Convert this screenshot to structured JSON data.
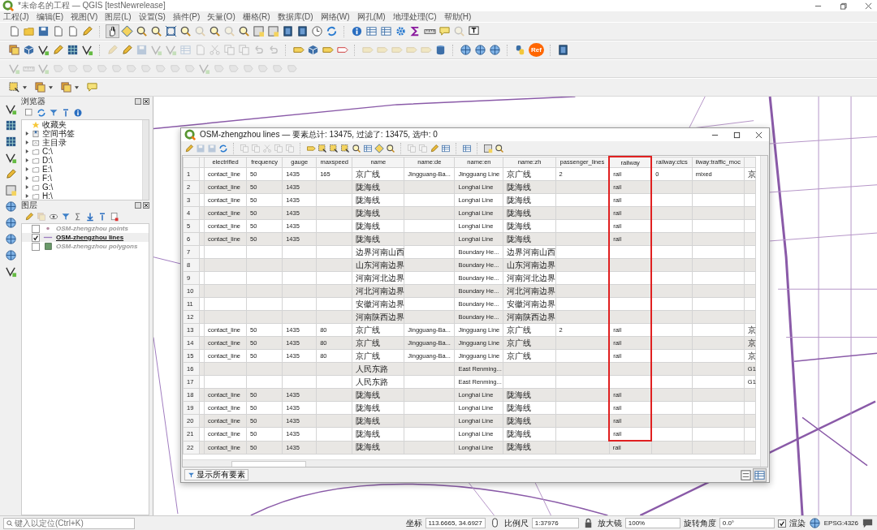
{
  "window": {
    "title": "*未命名的工程 — QGIS [testNewrelease]"
  },
  "menu": [
    "工程(J)",
    "编辑(E)",
    "视图(V)",
    "图层(L)",
    "设置(S)",
    "插件(P)",
    "矢量(O)",
    "栅格(R)",
    "数据库(D)",
    "网络(W)",
    "网孔(M)",
    "地理处理(C)",
    "帮助(H)"
  ],
  "toolbar": {
    "plugin_badge": "Ref"
  },
  "browser": {
    "title": "浏览器",
    "items": [
      {
        "label": "收藏夹",
        "kind": "favorites",
        "expandable": false
      },
      {
        "label": "空间书签",
        "kind": "bookmarks",
        "expandable": true
      },
      {
        "label": "主目录",
        "kind": "home",
        "expandable": true
      },
      {
        "label": "C:\\",
        "kind": "folder",
        "expandable": true
      },
      {
        "label": "D:\\",
        "kind": "folder",
        "expandable": true
      },
      {
        "label": "E:\\",
        "kind": "folder",
        "expandable": true
      },
      {
        "label": "F:\\",
        "kind": "folder",
        "expandable": true
      },
      {
        "label": "G:\\",
        "kind": "folder",
        "expandable": true
      },
      {
        "label": "H:\\",
        "kind": "folder",
        "expandable": true
      }
    ]
  },
  "layers": {
    "title": "图层",
    "items": [
      {
        "name": "OSM-zhengzhou points",
        "kind": "point",
        "checked": false,
        "current": false
      },
      {
        "name": "OSM-zhengzhou lines",
        "kind": "line",
        "checked": true,
        "current": true
      },
      {
        "name": "OSM-zhengzhou polygons",
        "kind": "polygon",
        "checked": false,
        "current": false
      }
    ]
  },
  "attribute_table": {
    "title": "OSM-zhengzhou lines — 要素总计: 13475, 过滤了: 13475, 选中: 0",
    "columns": [
      {
        "label": "electrified",
        "highlighted": false
      },
      {
        "label": "frequency",
        "highlighted": false
      },
      {
        "label": "gauge",
        "highlighted": false
      },
      {
        "label": "maxspeed",
        "highlighted": false
      },
      {
        "label": "name",
        "highlighted": false
      },
      {
        "label": "name:de",
        "highlighted": false
      },
      {
        "label": "name:en",
        "highlighted": false
      },
      {
        "label": "name:zh",
        "highlighted": false
      },
      {
        "label": "passenger_lines",
        "highlighted": false
      },
      {
        "label": "railway",
        "highlighted": true
      },
      {
        "label": "railway:ctcs",
        "highlighted": false
      },
      {
        "label": "ilway:traffic_moc",
        "highlighted": false
      },
      {
        "highlighted": false
      }
    ],
    "rows": [
      {
        "number": "1",
        "highlighted": true,
        "cells": [
          "contact_line",
          "50",
          "1435",
          "165",
          "京广线",
          "Jingguang-Ba...",
          "Jingguang Line",
          "京广线",
          "2",
          "rail",
          "0",
          "mixed",
          "京"
        ]
      },
      {
        "number": "2",
        "highlighted": true,
        "cells": [
          "contact_line",
          "50",
          "1435",
          null,
          "陇海线",
          null,
          "Longhai Line",
          "陇海线",
          null,
          "rail",
          null,
          null,
          null
        ]
      },
      {
        "number": "3",
        "highlighted": true,
        "cells": [
          "contact_line",
          "50",
          "1435",
          null,
          "陇海线",
          null,
          "Longhai Line",
          "陇海线",
          null,
          "rail",
          null,
          null,
          null
        ]
      },
      {
        "number": "4",
        "highlighted": true,
        "cells": [
          "contact_line",
          "50",
          "1435",
          null,
          "陇海线",
          null,
          "Longhai Line",
          "陇海线",
          null,
          "rail",
          null,
          null,
          null
        ]
      },
      {
        "number": "5",
        "highlighted": true,
        "cells": [
          "contact_line",
          "50",
          "1435",
          null,
          "陇海线",
          null,
          "Longhai Line",
          "陇海线",
          null,
          "rail",
          null,
          null,
          null
        ]
      },
      {
        "number": "6",
        "highlighted": true,
        "cells": [
          "contact_line",
          "50",
          "1435",
          null,
          "陇海线",
          null,
          "Longhai Line",
          "陇海线",
          null,
          "rail",
          null,
          null,
          null
        ]
      },
      {
        "number": "7",
        "highlighted": true,
        "cells": [
          null,
          null,
          null,
          null,
          "边界河南山西",
          null,
          "Boundary He...",
          "边界河南山西",
          null,
          null,
          null,
          null,
          null
        ]
      },
      {
        "number": "8",
        "highlighted": true,
        "cells": [
          null,
          null,
          null,
          null,
          "山东河南边界",
          null,
          "Boundary He...",
          "山东河南边界",
          null,
          null,
          null,
          null,
          null
        ]
      },
      {
        "number": "9",
        "highlighted": true,
        "cells": [
          null,
          null,
          null,
          null,
          "河南河北边界",
          null,
          "Boundary He...",
          "河南河北边界",
          null,
          null,
          null,
          null,
          null
        ]
      },
      {
        "number": "10",
        "highlighted": true,
        "cells": [
          null,
          null,
          null,
          null,
          "河北河南边界",
          null,
          "Boundary He...",
          "河北河南边界",
          null,
          null,
          null,
          null,
          null
        ]
      },
      {
        "number": "11",
        "highlighted": true,
        "cells": [
          null,
          null,
          null,
          null,
          "安徽河南边界",
          null,
          "Boundary He...",
          "安徽河南边界",
          null,
          null,
          null,
          null,
          null
        ]
      },
      {
        "number": "12",
        "highlighted": true,
        "cells": [
          null,
          null,
          null,
          null,
          "河南陕西边界",
          null,
          "Boundary He...",
          "河南陕西边界",
          null,
          null,
          null,
          null,
          null
        ]
      },
      {
        "number": "13",
        "highlighted": true,
        "cells": [
          "contact_line",
          "50",
          "1435",
          "80",
          "京广线",
          "Jingguang-Ba...",
          "Jingguang Line",
          "京广线",
          "2",
          "rail",
          null,
          null,
          "京"
        ]
      },
      {
        "number": "14",
        "highlighted": true,
        "cells": [
          "contact_line",
          "50",
          "1435",
          "80",
          "京广线",
          "Jingguang-Ba...",
          "Jingguang Line",
          "京广线",
          null,
          "rail",
          null,
          null,
          "京"
        ]
      },
      {
        "number": "15",
        "highlighted": true,
        "cells": [
          "contact_line",
          "50",
          "1435",
          "80",
          "京广线",
          "Jingguang-Ba...",
          "Jingguang Line",
          "京广线",
          null,
          "rail",
          null,
          null,
          "京"
        ]
      },
      {
        "number": "16",
        "highlighted": true,
        "cells": [
          null,
          null,
          null,
          null,
          "人民东路",
          null,
          "East Renming...",
          null,
          null,
          null,
          null,
          null,
          "G1"
        ]
      },
      {
        "number": "17",
        "highlighted": true,
        "cells": [
          null,
          null,
          null,
          null,
          "人民东路",
          null,
          "East Renming...",
          null,
          null,
          null,
          null,
          null,
          "G1"
        ]
      },
      {
        "number": "18",
        "highlighted": true,
        "cells": [
          "contact_line",
          "50",
          "1435",
          null,
          "陇海线",
          null,
          "Longhai Line",
          "陇海线",
          null,
          "rail",
          null,
          null,
          null
        ]
      },
      {
        "number": "19",
        "highlighted": true,
        "cells": [
          "contact_line",
          "50",
          "1435",
          null,
          "陇海线",
          null,
          "Longhai Line",
          "陇海线",
          null,
          "rail",
          null,
          null,
          null
        ]
      },
      {
        "number": "20",
        "highlighted": true,
        "cells": [
          "contact_line",
          "50",
          "1435",
          null,
          "陇海线",
          null,
          "Longhai Line",
          "陇海线",
          null,
          "rail",
          null,
          null,
          null
        ]
      },
      {
        "number": "21",
        "highlighted": true,
        "cells": [
          "contact_line",
          "50",
          "1435",
          null,
          "陇海线",
          null,
          "Longhai Line",
          "陇海线",
          null,
          "rail",
          null,
          null,
          null
        ]
      },
      {
        "number": "22",
        "highlighted": false,
        "cells": [
          "contact_line",
          "50",
          "1435",
          null,
          "陇海线",
          null,
          "Longhai Line",
          "陇海线",
          null,
          "rail",
          null,
          null,
          null
        ]
      }
    ],
    "filter_button": "显示所有要素"
  },
  "status_bar": {
    "locator_placeholder": "键入以定位(Ctrl+K)",
    "coordinate_label": "坐标",
    "coordinate": "113.6665, 34.6927",
    "scale_label": "比例尺",
    "scale": "1:37976",
    "magnifier_label": "放大镜",
    "magnifier": "100%",
    "rotation_label": "旋转角度",
    "rotation": "0.0°",
    "render_label": "渲染",
    "render_checked": true,
    "crs": "EPSG:4326"
  }
}
